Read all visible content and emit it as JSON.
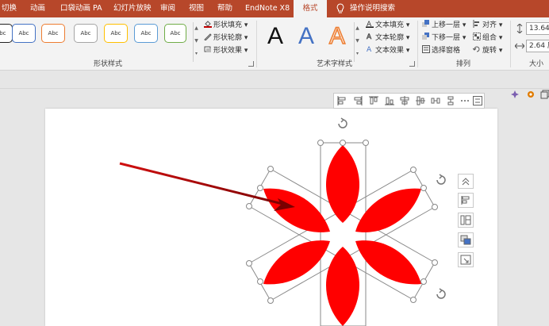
{
  "tabs": {
    "items": [
      {
        "label": "切换"
      },
      {
        "label": "动画"
      },
      {
        "label": "口袋动画 PA"
      },
      {
        "label": "幻灯片放映"
      },
      {
        "label": "审阅"
      },
      {
        "label": "视图"
      },
      {
        "label": "帮助"
      },
      {
        "label": "EndNote X8"
      },
      {
        "label": "格式"
      }
    ],
    "search_label": "操作说明搜索"
  },
  "shape_styles": {
    "presets": [
      "Abc",
      "Abc",
      "Abc",
      "Abc",
      "Abc",
      "Abc"
    ],
    "fill_label": "形状填充",
    "outline_label": "形状轮廓",
    "effect_label": "形状效果",
    "group_label": "形状样式"
  },
  "wordart": {
    "letters": [
      "A",
      "A",
      "A"
    ],
    "text_fill_label": "文本填充",
    "text_outline_label": "文本轮廓",
    "text_effect_label": "文本效果",
    "group_label": "艺术字样式"
  },
  "arrange": {
    "bring_forward_label": "上移一层",
    "send_backward_label": "下移一层",
    "selection_pane_label": "选择窗格",
    "align_label": "对齐",
    "group_btn_label": "组合",
    "rotate_label": "旋转",
    "group_label": "排列"
  },
  "size": {
    "height_value": "13.64 厘",
    "width_value": "2.64 厘",
    "group_label": "大小"
  },
  "colors": {
    "accent": "#b7472a",
    "petal": "#ff0000",
    "arrow": "#c00000"
  }
}
